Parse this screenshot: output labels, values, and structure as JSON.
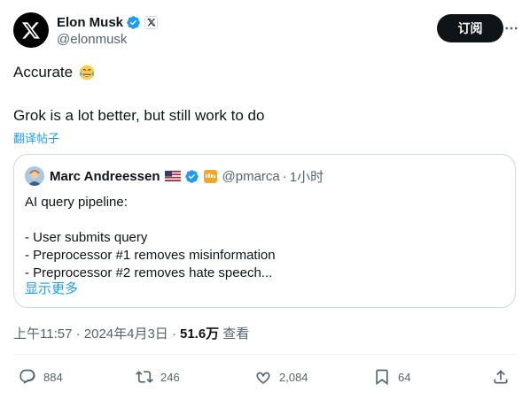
{
  "author": {
    "name": "Elon Musk",
    "handle": "@elonmusk"
  },
  "header": {
    "subscribe_label": "订阅"
  },
  "tweet": {
    "line1": "Accurate",
    "line2": "Grok is a lot better, but still work to do",
    "translate_label": "翻译帖子"
  },
  "quote": {
    "name": "Marc Andreessen",
    "handle": "@pmarca",
    "separator": "·",
    "time": "1小时",
    "lines": [
      "AI query pipeline:",
      "",
      "- User submits query",
      "- Preprocessor #1 removes misinformation",
      "- Preprocessor #2 removes hate speech..."
    ],
    "show_more": "显示更多"
  },
  "meta": {
    "timestamp": "上午11:57 · 2024年4月3日 ·",
    "views_count": "51.6万",
    "views_label": "查看"
  },
  "actions": {
    "replies": "884",
    "reposts": "246",
    "likes": "2,084",
    "bookmarks": "64"
  },
  "colors": {
    "accent": "#1d9bf0",
    "text": "#0f1419",
    "muted": "#536471",
    "border": "#cfd9de"
  }
}
